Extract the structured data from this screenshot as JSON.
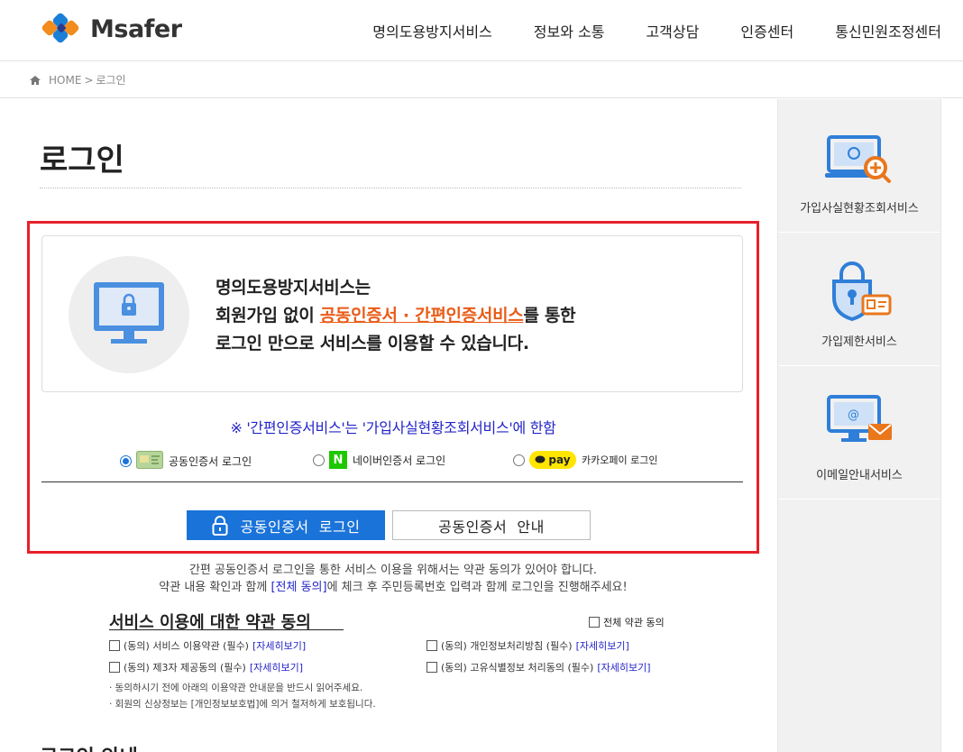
{
  "header": {
    "brand": "Msafer",
    "nav": [
      "명의도용방지서비스",
      "정보와 소통",
      "고객상담",
      "인증센터",
      "통신민원조정센터"
    ]
  },
  "breadcrumb": {
    "home": "HOME",
    "sep": ">",
    "current": "로그인"
  },
  "page": {
    "title": "로그인"
  },
  "intro": {
    "line1": "명의도용방지서비스는",
    "line2_prefix": "회원가입 없이 ",
    "line2_highlight": "공동인증서 · 간편인증서비스",
    "line2_suffix": "를 통한",
    "line3": "로그인 만으로 서비스를 이용할 수 있습니다."
  },
  "notice": "※ '간편인증서비스'는 '가입사실현황조회서비스'에 한함",
  "login_options": [
    {
      "label": "공동인증서 로그인",
      "selected": true,
      "icon": "certificate-card-icon"
    },
    {
      "label": "네이버인증서 로그인",
      "selected": false,
      "icon": "naver-icon",
      "icon_text": "N"
    },
    {
      "label": "카카오페이 로그인",
      "selected": false,
      "icon": "kakaopay-icon",
      "icon_text": "pay"
    }
  ],
  "buttons": {
    "primary": "공동인증서  로그인",
    "secondary": "공동인증서  안내"
  },
  "agree_guide": {
    "line1": "간편 공동인증서 로그인을 통한 서비스 이용을 위해서는 약관 동의가 있어야 합니다.",
    "line2_prefix": "약관 내용 확인과 함께 ",
    "line2_link": "[전체 동의]",
    "line2_suffix": "에 체크 후 주민등록번호 입력과 함께 로그인을 진행해주세요!"
  },
  "terms": {
    "title": "서비스 이용에 대한 약관 동의",
    "all_agree": "전체 약관 동의",
    "detail_link": "[자세히보기]",
    "items": [
      "(동의) 서비스 이용약관 (필수)",
      "(동의) 개인정보처리방침 (필수)",
      "(동의) 제3자 제공동의 (필수)",
      "(동의) 고유식별정보 처리동의 (필수)"
    ],
    "notes": [
      "· 동의하시기 전에 아래의 이용약관 안내문을 반드시 읽어주세요.",
      "· 회원의 신상정보는 [개인정보보호법]에 의거 철저하게 보호됩니다."
    ]
  },
  "bottom_heading": "로그인 안내",
  "sidebar": [
    {
      "label": "가입사실현황조회서비스",
      "icon": "monitor-search-icon"
    },
    {
      "label": "가입제한서비스",
      "icon": "lock-id-card-icon"
    },
    {
      "label": "이메일안내서비스",
      "icon": "monitor-email-icon"
    }
  ],
  "colors": {
    "accent": "#1a73d9",
    "highlight": "#e95c18",
    "frame": "#e8202a",
    "notice": "#2424c8"
  }
}
